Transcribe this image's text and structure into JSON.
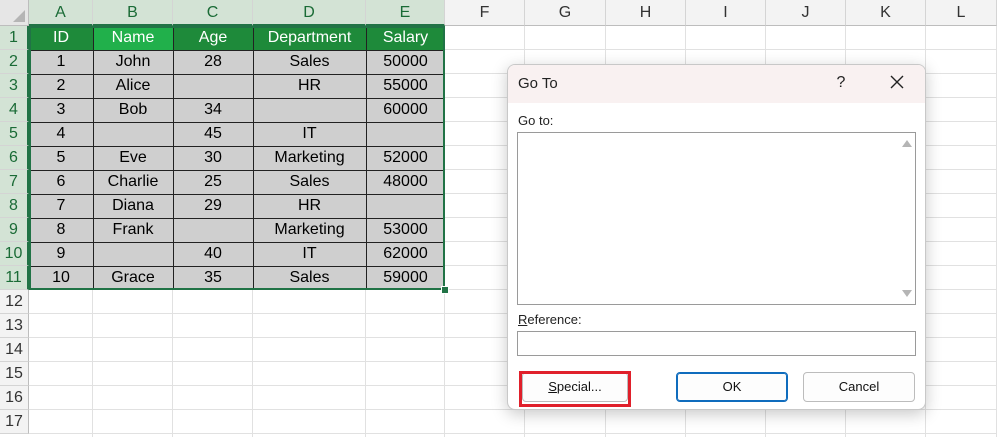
{
  "columns": [
    "A",
    "B",
    "C",
    "D",
    "E",
    "F",
    "G",
    "H",
    "I",
    "J",
    "K",
    "L"
  ],
  "rows": [
    "1",
    "2",
    "3",
    "4",
    "5",
    "6",
    "7",
    "8",
    "9",
    "10",
    "11",
    "12",
    "13",
    "14",
    "15",
    "16",
    "17"
  ],
  "table": {
    "headers": [
      "ID",
      "Name",
      "Age",
      "Department",
      "Salary"
    ],
    "body": [
      [
        "1",
        "John",
        "28",
        "Sales",
        "50000"
      ],
      [
        "2",
        "Alice",
        "",
        "HR",
        "55000"
      ],
      [
        "3",
        "Bob",
        "34",
        "",
        "60000"
      ],
      [
        "4",
        "",
        "45",
        "IT",
        ""
      ],
      [
        "5",
        "Eve",
        "30",
        "Marketing",
        "52000"
      ],
      [
        "6",
        "Charlie",
        "25",
        "Sales",
        "48000"
      ],
      [
        "7",
        "Diana",
        "29",
        "HR",
        ""
      ],
      [
        "8",
        "Frank",
        "",
        "Marketing",
        "53000"
      ],
      [
        "9",
        "",
        "40",
        "IT",
        "62000"
      ],
      [
        "10",
        "Grace",
        "35",
        "Sales",
        "59000"
      ]
    ]
  },
  "dialog": {
    "title": "Go To",
    "help": "?",
    "goto_label": "Go to:",
    "reference_label_underlined": "R",
    "reference_label_rest": "eference:",
    "reference_value": "",
    "special_button_underlined": "S",
    "special_button_rest": "pecial...",
    "ok_button": "OK",
    "cancel_button": "Cancel"
  },
  "colors": {
    "header_fill": "#1e8a3a",
    "active_header_fill": "#21b04b",
    "body_fill": "#cfcfcf",
    "highlight": "#e0202b",
    "selection": "#217346"
  }
}
